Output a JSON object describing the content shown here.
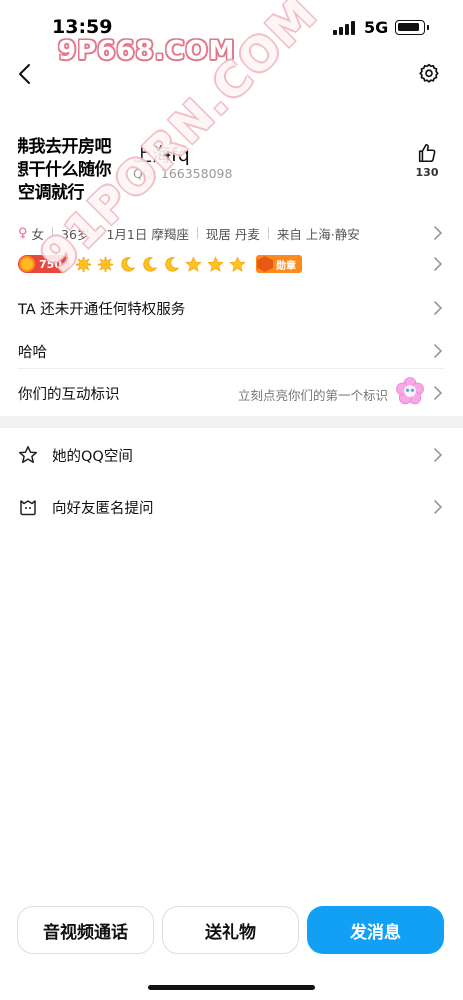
{
  "status_bar": {
    "time": "13:59",
    "network": "5G"
  },
  "watermarks": {
    "top": "9P668.COM",
    "diagonal": "91PORN.COM"
  },
  "profile": {
    "avatar_text": [
      "沸我去开房吧",
      "想干什么随你",
      "空调就行"
    ],
    "name": "上海fq",
    "qq_label": "QQ: 166358098",
    "likes": "130"
  },
  "info": {
    "gender": "女",
    "age": "36岁",
    "birthday": "1月1日 摩羯座",
    "residence": "现居 丹麦",
    "hometown": "来自 上海·静安"
  },
  "level": {
    "vip_value": "750",
    "medal_label": "勋章",
    "suns": 2,
    "moons": 3,
    "stars": 3
  },
  "rows": {
    "privilege": "TA 还未开通任何特权服务",
    "signature": "哈哈",
    "interaction_title": "你们的互动标识",
    "interaction_hint": "立刻点亮你们的第一个标识"
  },
  "links": {
    "qzone": "她的QQ空间",
    "anonymous": "向好友匿名提问"
  },
  "actions": {
    "call": "音视频通话",
    "gift": "送礼物",
    "message": "发消息"
  },
  "colors": {
    "primary": "#12a0f5",
    "badge_red": "#e8473d",
    "medal_orange": "#ff8a1c",
    "watermark_pink": "#e2788a"
  }
}
